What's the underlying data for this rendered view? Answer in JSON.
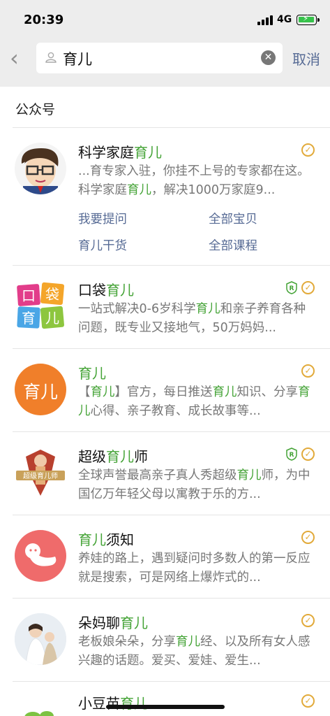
{
  "status": {
    "time": "20:39",
    "network": "4G"
  },
  "search": {
    "query": "育儿",
    "cancel_label": "取消"
  },
  "section_title": "公众号",
  "results": [
    {
      "name_parts": [
        "科学家庭",
        "育儿",
        ""
      ],
      "desc_html_parts": [
        "...育专家入驻，你挂不上号的专家都在这。科学家庭",
        "育儿",
        "，解决1000万家庭9..."
      ],
      "links": [
        "我要提问",
        "全部宝贝",
        "育儿干货",
        "全部课程"
      ],
      "verified": true,
      "trademark": false
    },
    {
      "name_parts": [
        "口袋",
        "育儿",
        ""
      ],
      "desc_html_parts": [
        "一站式解决0-6岁科学",
        "育儿",
        "和亲子养育各种问题，既专业又接地气，50万妈妈..."
      ],
      "verified": true,
      "trademark": true
    },
    {
      "name_parts": [
        "",
        "育儿",
        ""
      ],
      "desc_html_parts": [
        "【",
        "育儿",
        "】官方，每日推送",
        "育儿",
        "知识、分享",
        "育儿",
        "心得、亲子教育、成长故事等..."
      ],
      "verified": true,
      "trademark": false
    },
    {
      "name_parts": [
        "超级",
        "育儿",
        "师"
      ],
      "desc_html_parts": [
        "全球声誉最高亲子真人秀超级",
        "育儿",
        "师，为中国亿万年轻父母以寓教于乐的方..."
      ],
      "verified": true,
      "trademark": true
    },
    {
      "name_parts": [
        "",
        "育儿",
        "须知"
      ],
      "desc_html_parts": [
        "养娃的路上，遇到疑问时多数人的第一反应就是搜索，可是网络上爆炸式的..."
      ],
      "verified": true,
      "trademark": false
    },
    {
      "name_parts": [
        "朵妈聊",
        "育儿",
        ""
      ],
      "desc_html_parts": [
        "老板娘朵朵，分享",
        "育儿",
        "经、以及所有女人感兴趣的话题。爱买、爱娃、爱生..."
      ],
      "verified": true,
      "trademark": false
    },
    {
      "name_parts": [
        "小豆苗",
        "育儿",
        ""
      ],
      "desc_html_parts": [],
      "verified": true,
      "trademark": false
    }
  ],
  "avatar_texts": {
    "koudai": [
      "口",
      "袋",
      "育",
      "儿"
    ],
    "yuer": "育儿",
    "chaoji_banner": "超级育儿师"
  },
  "colors": {
    "accent_green": "#44a336",
    "link_blue": "#576b95",
    "verify_gold": "#e2aa3a"
  }
}
